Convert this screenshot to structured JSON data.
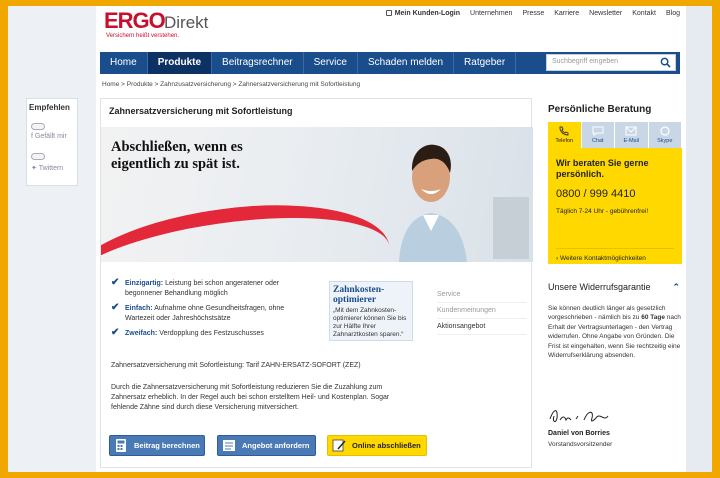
{
  "logo": {
    "ergo": "ERGO",
    "direkt": "Direkt",
    "tagline": "Versichern heißt verstehen."
  },
  "topnav": {
    "login": "Mein Kunden-Login",
    "items": [
      "Unternehmen",
      "Presse",
      "Karriere",
      "Newsletter",
      "Kontakt",
      "Blog"
    ]
  },
  "mainnav": {
    "items": [
      "Home",
      "Produkte",
      "Beitragsrechner",
      "Service",
      "Schaden melden",
      "Ratgeber"
    ],
    "active": "Produkte"
  },
  "search": {
    "placeholder": "Suchbegriff eingeben"
  },
  "breadcrumb": "Home > Produkte > Zahnzusatzversicherung > Zahnersatzversicherung mit Sofortleistung",
  "share": {
    "title": "Empfehlen",
    "facebook": "Gefällt mir",
    "twitter": "Twittern"
  },
  "main": {
    "title": "Zahnersatzversicherung mit Sofortleistung",
    "hero_line1": "Abschließen, wenn es",
    "hero_line2": "eigentlich zu spät ist.",
    "bullets": [
      {
        "bold": "Einzigartig:",
        "text": "Leistung bei schon angeratener oder begonnener Behandlung möglich"
      },
      {
        "bold": "Einfach:",
        "text": "Aufnahme ohne Gesundheitsfragen, ohne Wartezeit oder Jahreshöchstsätze"
      },
      {
        "bold": "Zweifach:",
        "text": "Verdopplung des Festzuschusses"
      }
    ],
    "optimizer_title": "Zahnkosten-optimierer",
    "optimizer_quote": "„Mit dem Zahnkosten-optimierer können Sie bis zur Hälfte Ihrer Zahnarztkosten sparen.“",
    "tabs": [
      "Service",
      "Kundenmeinungen",
      "Aktionsangebot"
    ],
    "tariff": "Zahnersatzversicherung mit Sofortleistung: Tarif ZAHN-ERSATZ-SOFORT (ZEZ)",
    "description": "Durch die Zahnersatzversicherung mit Sofortleistung  reduzieren Sie die Zuzahlung zum Zahnersatz erheblich. In der Regel auch bei schon erstelltem Heil- und Kostenplan. Sogar fehlende Zähne sind durch diese Versicherung mitversichert.",
    "buttons": [
      "Beitrag berechnen",
      "Angebot anfordern",
      "Online abschließen"
    ]
  },
  "right": {
    "heading": "Persönliche Beratung",
    "tabs": [
      "Telefon",
      "Chat",
      "E-Mail",
      "Skype"
    ],
    "callout": "Wir beraten Sie gerne persönlich.",
    "phone": "0800 / 999 4410",
    "hours": "Täglich 7-24 Uhr - gebührenfrei!",
    "more": "Weitere Kontaktmöglichkeiten",
    "guarantee_title": "Unsere Widerrufsgarantie",
    "guarantee_pre": "Sie können deutlich länger als gesetzlich vorgeschrieben - nämlich bis zu ",
    "guarantee_bold": "60 Tage",
    "guarantee_post": " nach Erhalt der Vertragsunterlagen - den Vertrag widerrufen. Ohne Angabe von Gründen. Die Frist ist eingehalten, wenn Sie rechtzeitig eine Widerrufserklärung absenden.",
    "signer_name": "Daniel von Borries",
    "signer_title": "Vorstandsvorsitzender"
  },
  "colors": {
    "brand_red": "#c8102e",
    "nav_blue": "#1a4d8c",
    "accent_yellow": "#ffd800",
    "frame_orange": "#f0a800"
  }
}
